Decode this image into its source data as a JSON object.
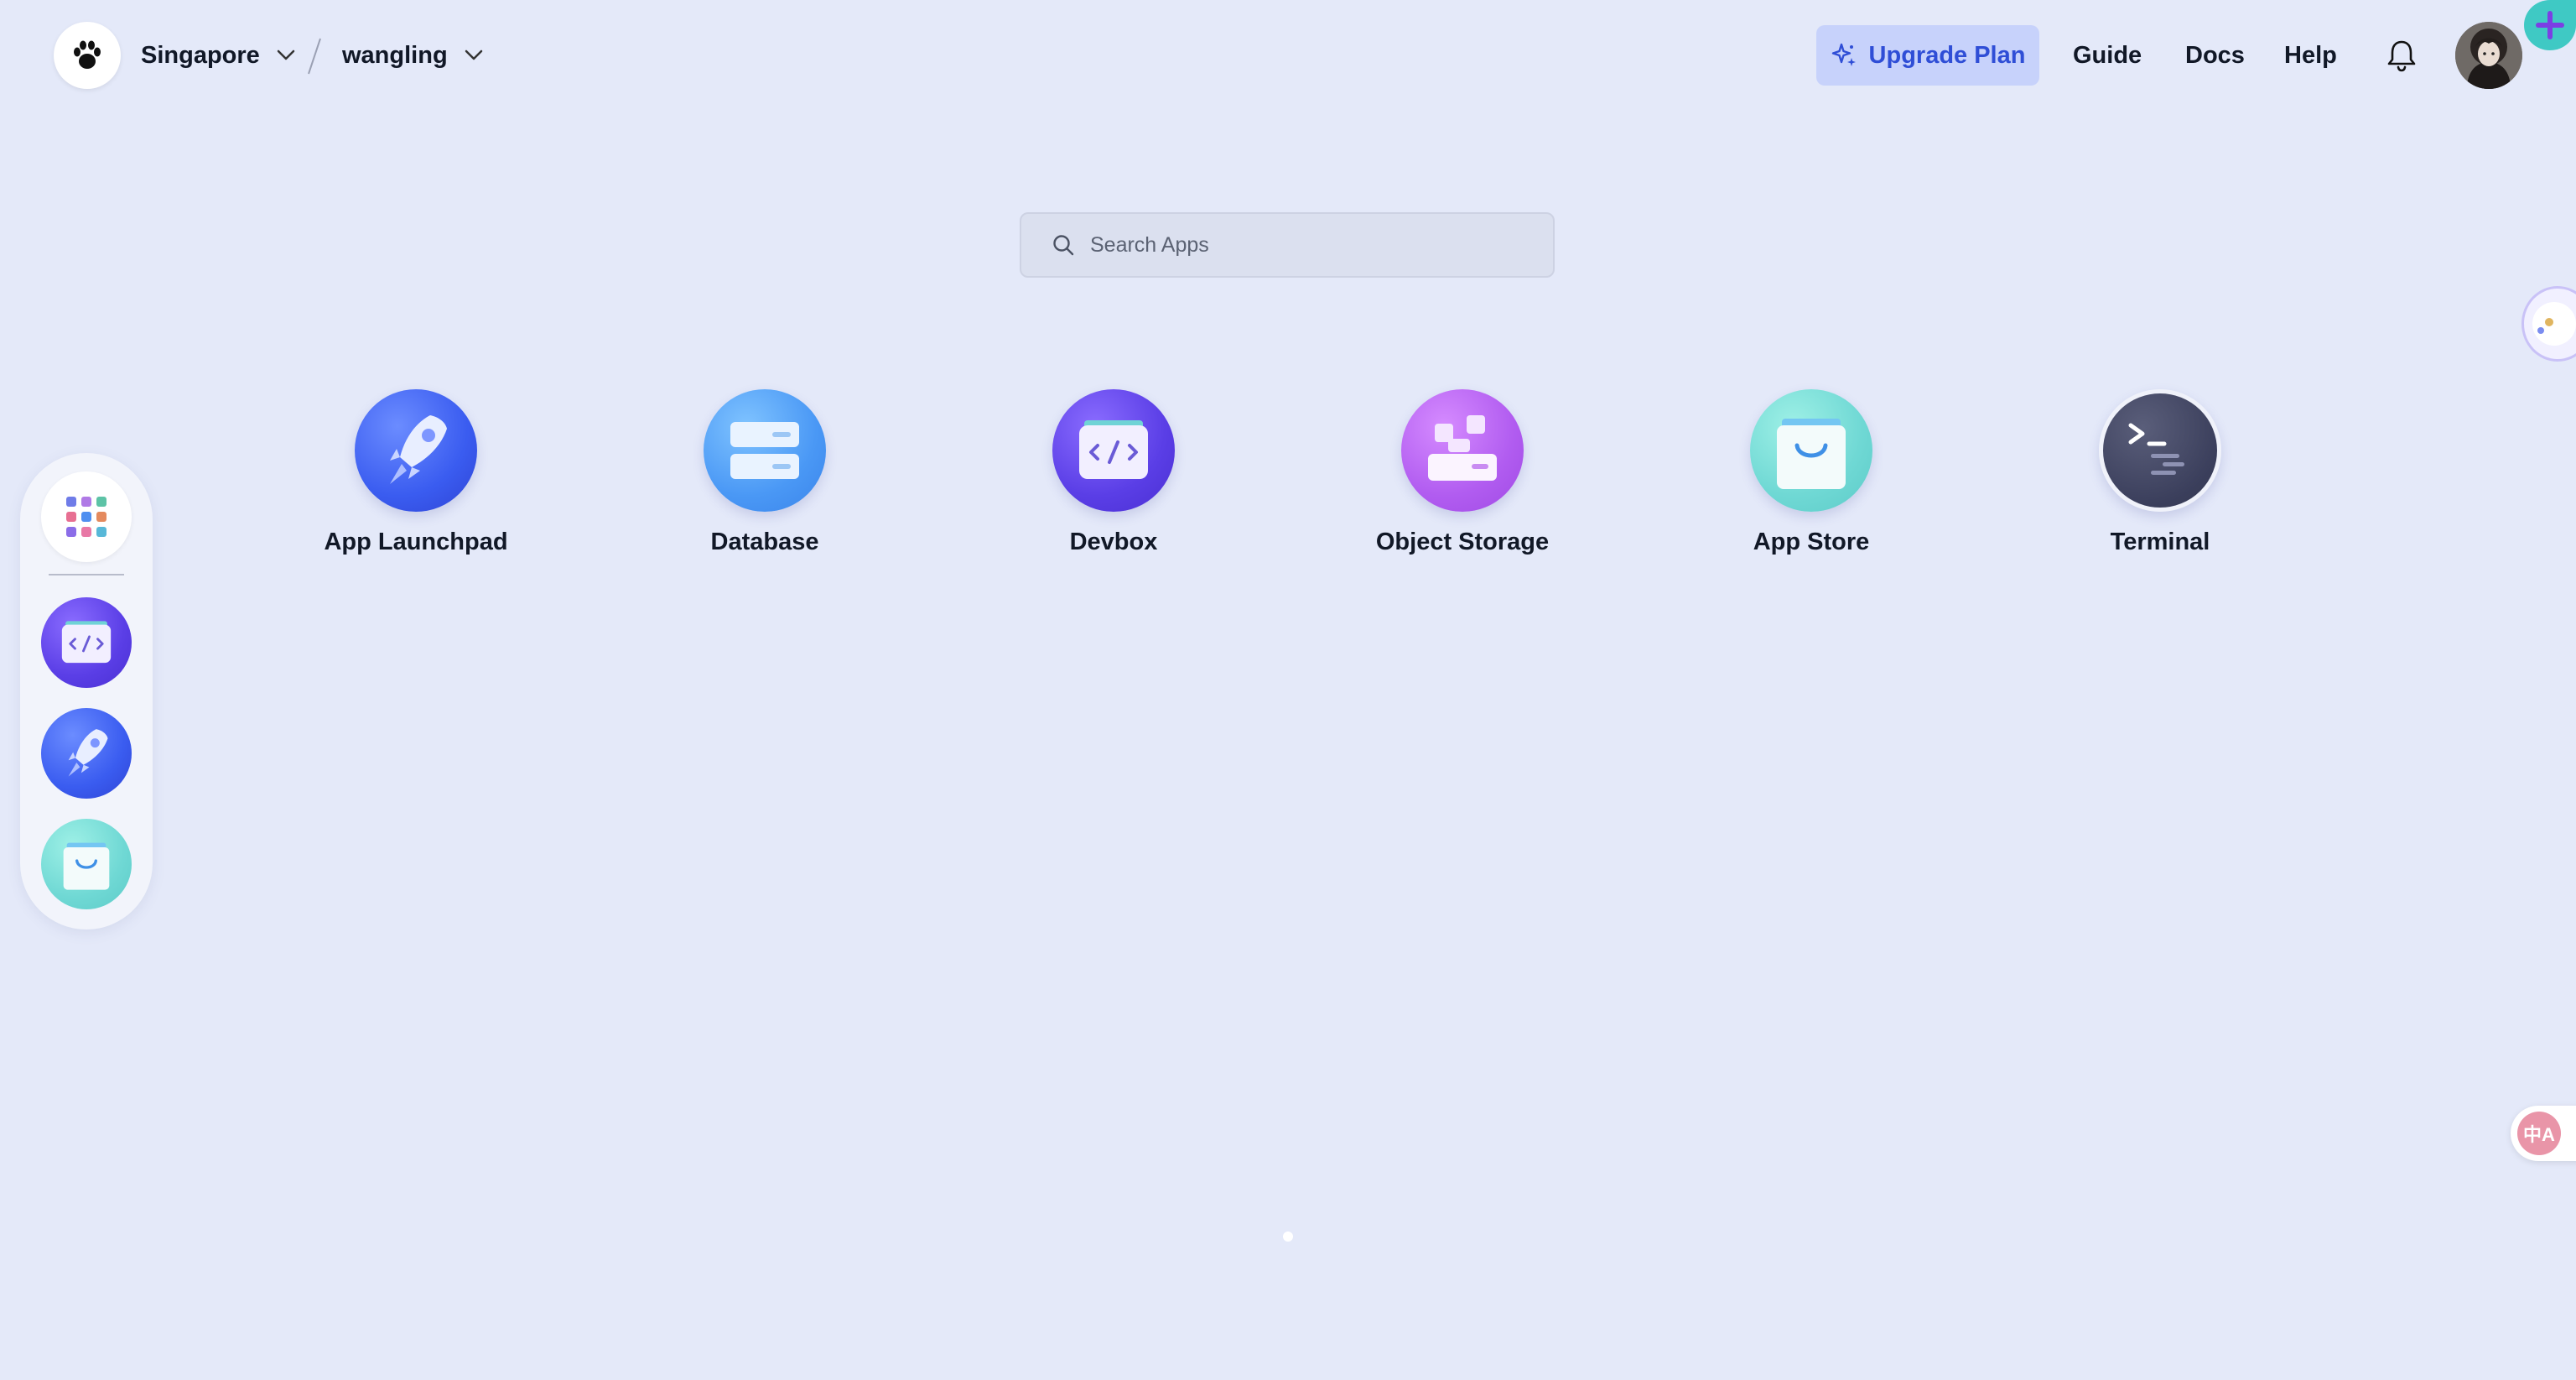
{
  "header": {
    "region": "Singapore",
    "workspace": "wangling",
    "upgrade_label": "Upgrade Plan",
    "nav": {
      "guide": "Guide",
      "docs": "Docs",
      "help": "Help"
    }
  },
  "search": {
    "placeholder": "Search Apps",
    "value": ""
  },
  "apps": [
    {
      "label": "App Launchpad",
      "icon": "rocket-icon"
    },
    {
      "label": "Database",
      "icon": "database-icon"
    },
    {
      "label": "Devbox",
      "icon": "code-box-icon"
    },
    {
      "label": "Object Storage",
      "icon": "object-storage-icon"
    },
    {
      "label": "App Store",
      "icon": "shopping-bag-icon"
    },
    {
      "label": "Terminal",
      "icon": "terminal-icon"
    }
  ],
  "dock": {
    "items": [
      "apps-grid-icon",
      "code-box-icon",
      "rocket-icon",
      "shopping-bag-icon"
    ]
  },
  "translate_badge": "中A",
  "colors": {
    "background": "#e4e9f9",
    "accent": "#2f4ed6",
    "upgrade_bg": "#c7d2fb",
    "plus_fab": "#3fc9c4"
  },
  "pagination": {
    "current": 1,
    "total": 1
  }
}
